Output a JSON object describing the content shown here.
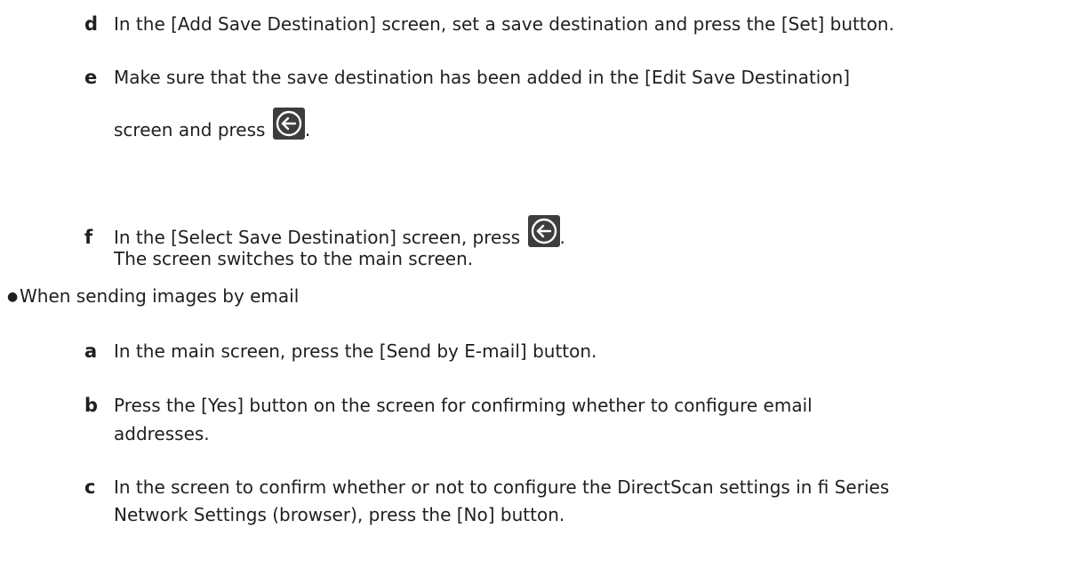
{
  "steps_top": {
    "d": {
      "letter": "d",
      "text": "In the [Add Save Destination] screen, set a save destination and press the [Set] button."
    },
    "e": {
      "letter": "e",
      "line1": "Make sure that the save destination has been added in the [Edit Save Destination]",
      "line2_before": "screen and press",
      "line2_after": "."
    },
    "f": {
      "letter": "f",
      "line1_before": "In the [Select Save Destination] screen, press",
      "line1_after": ".",
      "line2": "The screen switches to the main screen."
    }
  },
  "bullet": {
    "symbol": "●",
    "text": "When sending images by email"
  },
  "steps_email": {
    "a": {
      "letter": "a",
      "text": "In the main screen, press the [Send by E-mail] button."
    },
    "b": {
      "letter": "b",
      "line1": "Press the [Yes] button on the screen for confirming whether to configure email",
      "line2": "addresses."
    },
    "c": {
      "letter": "c",
      "line1": "In the screen to confirm whether or not to configure the DirectScan settings in fi Series",
      "line2": "Network Settings (browser), press the [No] button."
    }
  },
  "icons": {
    "back": "back-arrow-circle-icon"
  },
  "colors": {
    "text": "#1f1f1f",
    "icon_bg": "#3d3d3d"
  }
}
